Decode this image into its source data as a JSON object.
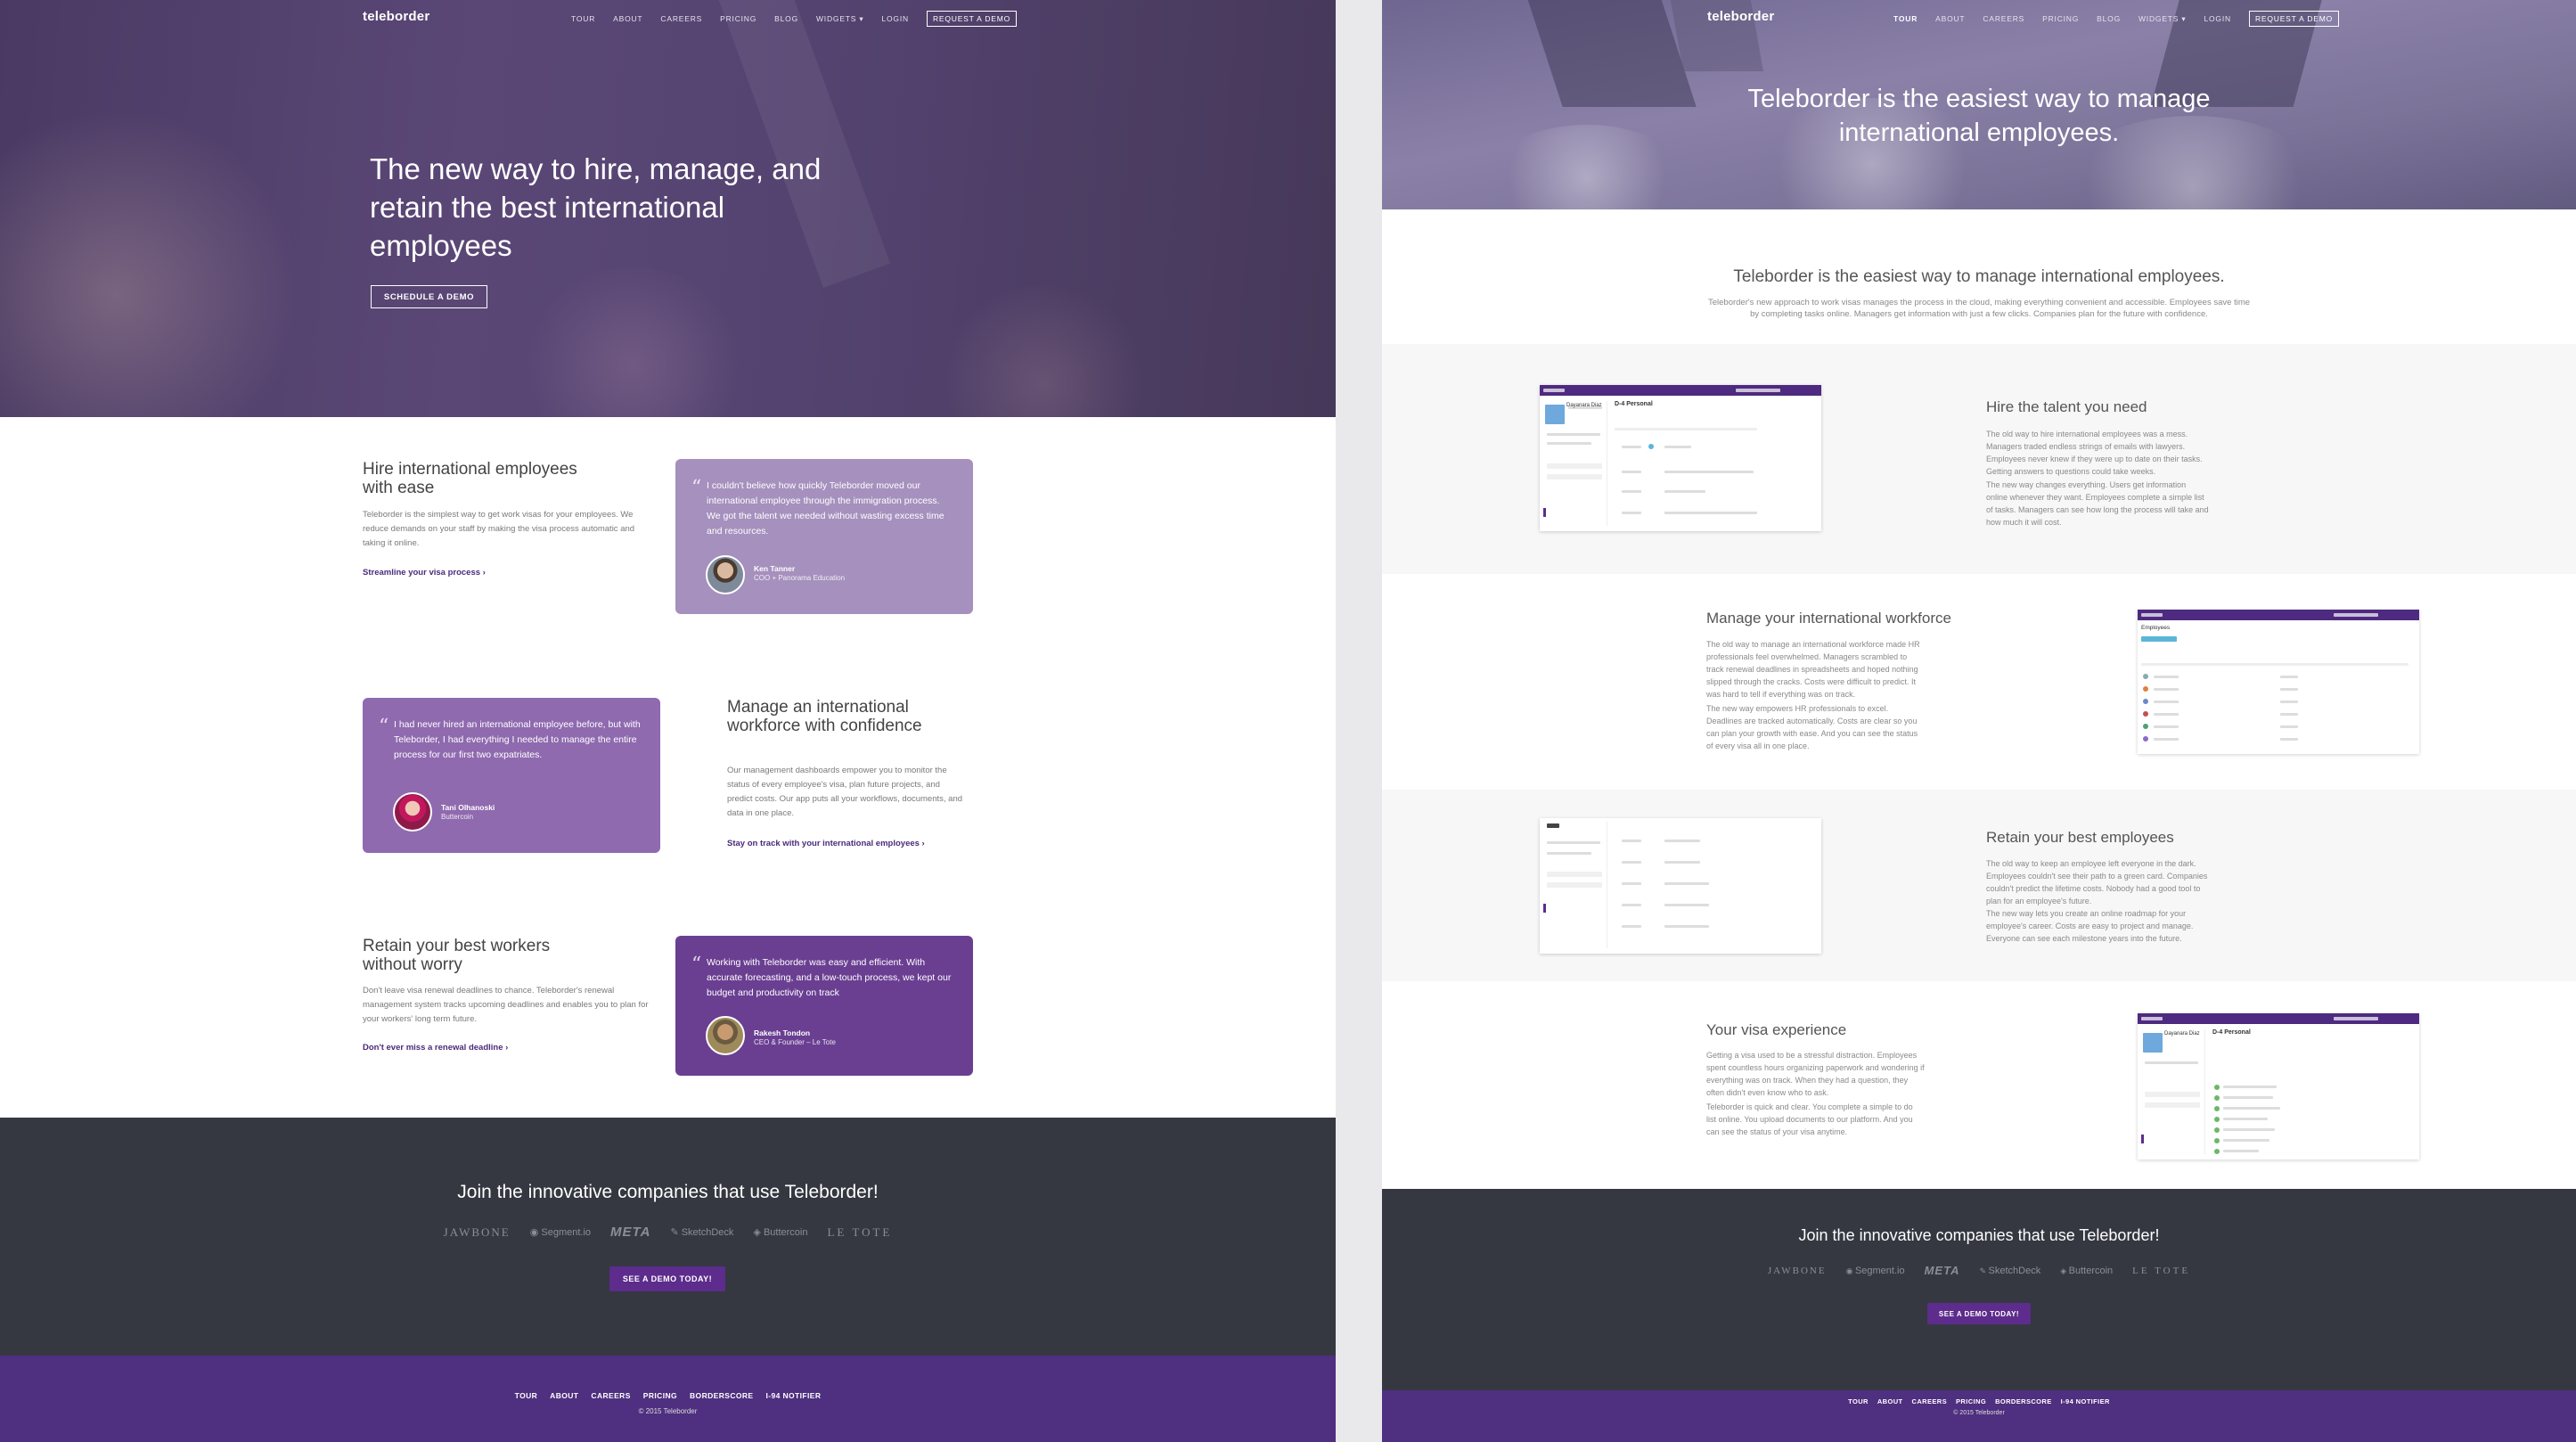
{
  "nav": {
    "logo": "teleborder",
    "items": [
      "TOUR",
      "ABOUT",
      "CAREERS",
      "PRICING",
      "BLOG",
      "WIDGETS ▾",
      "LOGIN"
    ],
    "cta": "REQUEST A DEMO"
  },
  "home": {
    "hero_title": "The new way to hire, manage, and retain the best international employees",
    "hero_button": "SCHEDULE A DEMO",
    "features": [
      {
        "title": "Hire international employees with ease",
        "body": "Teleborder is the simplest way to get work visas for your employees. We reduce demands on your staff by making the visa process automatic and taking it online.",
        "link": "Streamline your visa process ›",
        "quote": "I couldn't believe how quickly Teleborder moved our international employee through the immigration process. We got the talent we needed without wasting excess time and resources.",
        "name": "Ken Tanner",
        "role": "COO + Panorama Education"
      },
      {
        "title": "Manage an international workforce with confidence",
        "body": "Our management dashboards empower you to monitor the status of every employee's visa, plan future projects, and predict costs. Our app puts all your workflows, documents, and data in one place.",
        "link": "Stay on track with your international employees ›",
        "quote": "I had never hired an international employee before, but with Teleborder, I had everything I needed to manage the entire process for our first two expatriates.",
        "name": "Tani Olhanoski",
        "role": "Buttercoin"
      },
      {
        "title": "Retain your best workers without worry",
        "body": "Don't leave visa renewal deadlines to chance. Teleborder's renewal management system tracks upcoming deadlines and enables you to plan for your workers' long term future.",
        "link": "Don't ever miss a renewal deadline ›",
        "quote": "Working with Teleborder was easy and efficient. With accurate forecasting, and a low-touch process, we kept our budget and productivity on track",
        "name": "Rakesh Tondon",
        "role": "CEO & Founder – Le Tote"
      }
    ],
    "customers_title": "Join the innovative companies that use Teleborder!",
    "customer_logos": [
      "JAWBONE",
      "Segment.io",
      "META",
      "SketchDeck",
      "Buttercoin",
      "LE TOTE"
    ],
    "customers_button": "SEE A DEMO TODAY!",
    "footer_links": [
      "TOUR",
      "ABOUT",
      "CAREERS",
      "PRICING",
      "BORDERSCORE",
      "I-94 NOTIFIER"
    ],
    "copyright": "© 2015 Teleborder"
  },
  "tour": {
    "hero_title": "Teleborder is the easiest way to manage international employees.",
    "intro_title": "Teleborder is the easiest way to manage international employees.",
    "intro_body": "Teleborder's new approach to work visas manages the process in the cloud, making everything convenient and accessible. Employees save time by completing tasks online. Managers get information with just a few clicks. Companies plan for the future with confidence.",
    "sections": [
      {
        "title": "Hire the talent you need",
        "p1": "The old way to hire international employees was a mess. Managers traded endless strings of emails with lawyers. Employees never knew if they were up to date on their tasks. Getting answers to questions could take weeks.",
        "p2": "The new way changes everything. Users get information online whenever they want. Employees complete a simple list of tasks. Managers can see how long the process will take and how much it will cost."
      },
      {
        "title": "Manage your international workforce",
        "p1": "The old way to manage an international workforce made HR professionals feel overwhelmed. Managers scrambled to track renewal deadlines in spreadsheets and hoped nothing slipped through the cracks. Costs were difficult to predict. It was hard to tell if everything was on track.",
        "p2": "The new way empowers HR professionals to excel. Deadlines are tracked automatically. Costs are clear so you can plan your growth with ease. And you can see the status of every visa all in one place."
      },
      {
        "title": "Retain your best employees",
        "p1": "The old way to keep an employee left everyone in the dark. Employees couldn't see their path to a green card. Companies couldn't predict the lifetime costs. Nobody had a good tool to plan for an employee's future.",
        "p2": "The new way lets you create an online roadmap for your employee's career. Costs are easy to project and manage. Everyone can see each milestone years into the future."
      },
      {
        "title": "Your visa experience",
        "p1": "Getting a visa used to be a stressful distraction. Employees spent countless hours organizing paperwork and wondering if everything was on track. When they had a question, they often didn't even know who to ask.",
        "p2": "Teleborder is quick and clear. You complete a simple to do list online. You upload documents to our platform. And you can see the status of your visa anytime."
      }
    ],
    "mock_labels": {
      "person": "Dayanara Diaz",
      "personal": "D-4 Personal",
      "employees": "Employees"
    },
    "customers_title": "Join the innovative companies that use Teleborder!",
    "customers_button": "SEE A DEMO TODAY!",
    "copyright": "© 2015 Teleborder"
  },
  "colors": {
    "purple_dark": "#5d2c8c",
    "quote_light": "#a690bd",
    "quote_mid": "#8f6aaf",
    "quote_dark": "#6a3f92",
    "footer": "#4f2f7f",
    "customers_bg": "#353841"
  }
}
